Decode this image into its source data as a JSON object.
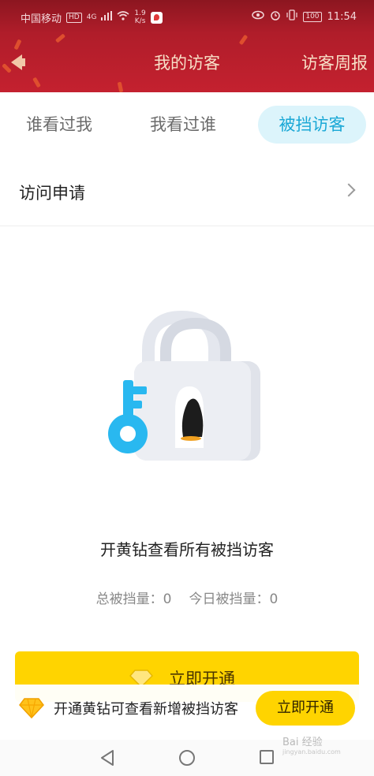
{
  "status_bar": {
    "carrier": "中国移动",
    "hd": "HD",
    "network": "4G",
    "speed_value": "1.9",
    "speed_unit": "K/s",
    "battery": "100",
    "time": "11:54"
  },
  "header": {
    "title": "我的访客",
    "weekly_report": "访客周报"
  },
  "tabs": [
    {
      "label": "谁看过我",
      "active": false
    },
    {
      "label": "我看过谁",
      "active": false
    },
    {
      "label": "被挡访客",
      "active": true
    }
  ],
  "access_request": {
    "label": "访问申请"
  },
  "empty_state": {
    "message": "开黄钻查看所有被挡访客",
    "total_blocked_label": "总被挡量：",
    "total_blocked_value": "0",
    "today_blocked_label": "今日被挡量：",
    "today_blocked_value": "0"
  },
  "activate_button": {
    "label": "立即开通"
  },
  "bottom_banner": {
    "text": "开通黄钻可查看新增被挡访客",
    "button_label": "立即开通"
  },
  "watermark": {
    "text": "Bai 经验",
    "sub": "jingyan.baidu.com"
  },
  "colors": {
    "header_red": "#c4212f",
    "active_tab_bg": "#dcf4fb",
    "active_tab_text": "#1aa8d6",
    "yellow": "#ffd400",
    "key_blue": "#29b8f0"
  }
}
